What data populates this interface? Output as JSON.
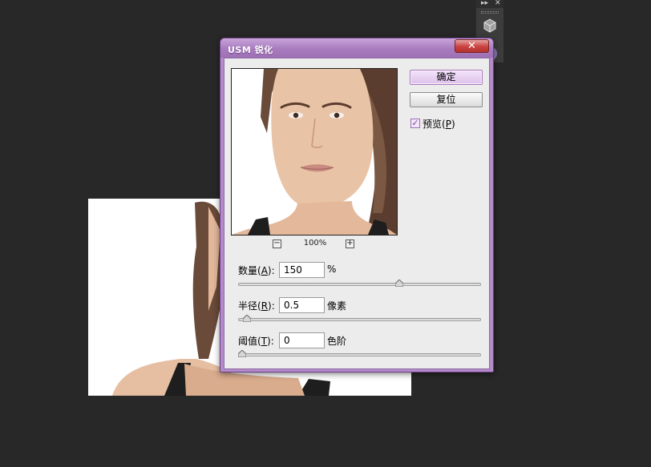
{
  "dialog": {
    "title": "USM 锐化",
    "close_glyph": "✕",
    "ok_label": "确定",
    "reset_label": "复位",
    "preview_check": {
      "label_prefix": "预览(",
      "label_key": "P",
      "label_suffix": ")",
      "checked": true,
      "check_glyph": "✓"
    },
    "zoom": {
      "level": "100%",
      "minus": "−",
      "plus": "+"
    }
  },
  "params": {
    "amount": {
      "label_prefix": "数量(",
      "label_key": "A",
      "label_suffix": "):",
      "value": "150",
      "unit": "%",
      "slider_fraction": 0.67
    },
    "radius": {
      "label_prefix": "半径(",
      "label_key": "R",
      "label_suffix": "):",
      "value": "0.5",
      "unit": "像素",
      "slider_fraction": 0.02
    },
    "threshold": {
      "label_prefix": "阈值(",
      "label_key": "T",
      "label_suffix": "):",
      "value": "0",
      "unit": "色阶",
      "slider_fraction": 0.0
    }
  },
  "panel": {
    "expand_glyph": "▸▸",
    "close_glyph": "✕",
    "icon": "cube-icon"
  },
  "colors": {
    "accent": "#b48ac8",
    "titlebar": "#a77bbd",
    "close": "#c9413f",
    "workspace": "#282828"
  }
}
